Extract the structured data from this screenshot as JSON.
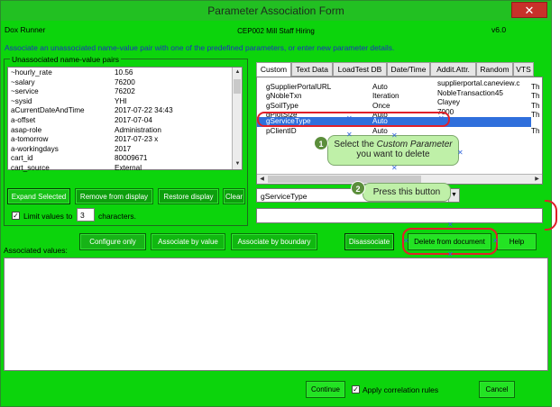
{
  "window": {
    "title": "Parameter Association Form",
    "close_glyph": "✕"
  },
  "header": {
    "app_name": "Dox Runner",
    "script_name": "CEP002 Mill Staff Hiring",
    "version": "v6.0",
    "instructions": "Associate an unassociated name-value pair with one of the predefined parameters, or enter new parameter details."
  },
  "unassociated": {
    "group_label": "Unassociated name-value pairs",
    "rows": [
      {
        "name": "~hourly_rate",
        "value": "10.56"
      },
      {
        "name": "~salary",
        "value": "76200"
      },
      {
        "name": "~service",
        "value": "76202"
      },
      {
        "name": "~sysid",
        "value": "YHI"
      },
      {
        "name": "aCurrentDateAndTime",
        "value": "2017-07-22 34:43"
      },
      {
        "name": "a-offset",
        "value": "2017-07-04"
      },
      {
        "name": "asap-role",
        "value": "Administration"
      },
      {
        "name": "a-tomorrow",
        "value": "2017-07-23 x"
      },
      {
        "name": "a-workingdays",
        "value": "2017"
      },
      {
        "name": "cart_id",
        "value": "80009671"
      },
      {
        "name": "cart_source",
        "value": "External"
      }
    ],
    "buttons": {
      "expand": "Expand Selected",
      "remove": "Remove from display",
      "restore": "Restore display",
      "clear": "Clear"
    },
    "limit": {
      "checked": true,
      "label_before": "Limit values to",
      "value": "3",
      "label_after": "characters."
    }
  },
  "tabs": [
    "Custom",
    "Text Data",
    "LoadTest DB",
    "Date/Time",
    "Addit.Attr.",
    "Random",
    "VTS"
  ],
  "custom_params": {
    "rows": [
      {
        "name": "gSupplierPortalURL",
        "mode": "Auto",
        "value": "supplierportal.caneview.c",
        "tail": "Th"
      },
      {
        "name": "gNobleTxn",
        "mode": "Iteration",
        "value": "NobleTransaction45",
        "tail": "Th"
      },
      {
        "name": "gSoilType",
        "mode": "Once",
        "value": "Clayey",
        "tail": "Th"
      },
      {
        "name": "gPlotSize",
        "mode": "Auto",
        "value": "7000",
        "tail": "Th"
      },
      {
        "name": "gServiceType",
        "mode": "Auto",
        "value": "",
        "tail": "Th"
      },
      {
        "name": "pClientID",
        "mode": "Auto",
        "value": "",
        "tail": "Th"
      }
    ],
    "selected_index": 4,
    "dropdown_value": "gServiceType",
    "text_value": ""
  },
  "actions": {
    "configure": "Configure only",
    "assoc_value": "Associate by value",
    "assoc_boundary": "Associate by boundary",
    "disassociate": "Disassociate",
    "delete": "Delete from document",
    "help": "Help"
  },
  "associated": {
    "label": "Associated values:"
  },
  "footer": {
    "continue": "Continue",
    "apply_checked": true,
    "apply_label": "Apply correlation rules",
    "cancel": "Cancel"
  },
  "callouts": [
    {
      "num": "1",
      "line1_prefix": "Select the ",
      "line1_em": "Custom Parameter",
      "line2": "you want to delete"
    },
    {
      "num": "2",
      "text": "Press this button"
    }
  ],
  "colors": {
    "window_bg": "#0cd40c",
    "highlight_red": "#e0202a",
    "selection_blue": "#2f6fdc",
    "callout_bg": "#bff0a8"
  }
}
